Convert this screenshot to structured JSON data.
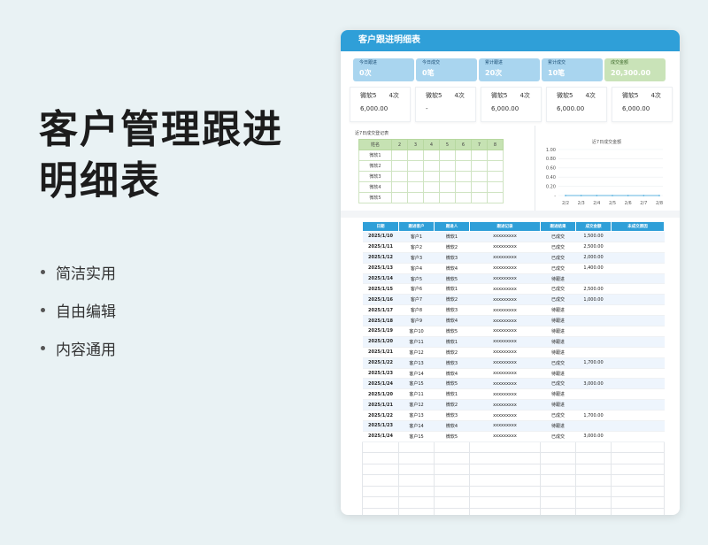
{
  "promo": {
    "title_line1": "客户管理跟进",
    "title_line2": "明细表",
    "bullets": [
      "简洁实用",
      "自由编辑",
      "内容通用"
    ]
  },
  "sheet": {
    "title": "客户跟进明细表",
    "stats": [
      {
        "label": "今日跟进",
        "value": "0次",
        "color": "#a9d5ef"
      },
      {
        "label": "今日成交",
        "value": "0笔",
        "color": "#a9d5ef"
      },
      {
        "label": "累计跟进",
        "value": "20次",
        "color": "#a9d5ef"
      },
      {
        "label": "累计成交",
        "value": "10笔",
        "color": "#a9d5ef"
      },
      {
        "label": "成交金额",
        "value": "20,300.00",
        "color": "#c9e3b8"
      }
    ],
    "cards": [
      {
        "name": "微软5",
        "count": "4次",
        "amount": "6,000.00"
      },
      {
        "name": "微软5",
        "count": "4次",
        "amount": "-"
      },
      {
        "name": "微软5",
        "count": "4次",
        "amount": "6,000.00"
      },
      {
        "name": "微软5",
        "count": "4次",
        "amount": "6,000.00"
      },
      {
        "name": "微软5",
        "count": "4次",
        "amount": "6,000.00"
      }
    ],
    "mini_table": {
      "title": "近7日成交登记表",
      "header": [
        "姓名",
        "2",
        "3",
        "4",
        "5",
        "6",
        "7",
        "8"
      ],
      "rows": [
        "微软1",
        "微软2",
        "微软3",
        "微软4",
        "微软5"
      ]
    },
    "main_table": {
      "headers": [
        "日期",
        "跟进客户",
        "跟进人",
        "跟进记录",
        "跟进结果",
        "成交金额",
        "未成交原因"
      ],
      "rows": [
        [
          "2025/1/10",
          "客户1",
          "微软1",
          "xxxxxxxxx",
          "已成交",
          "1,500.00",
          ""
        ],
        [
          "2025/1/11",
          "客户2",
          "微软2",
          "xxxxxxxxx",
          "已成交",
          "2,500.00",
          ""
        ],
        [
          "2025/1/12",
          "客户3",
          "微软3",
          "xxxxxxxxx",
          "已成交",
          "2,000.00",
          ""
        ],
        [
          "2025/1/13",
          "客户4",
          "微软4",
          "xxxxxxxxx",
          "已成交",
          "1,400.00",
          ""
        ],
        [
          "2025/1/14",
          "客户5",
          "微软5",
          "xxxxxxxxx",
          "待跟进",
          "",
          ""
        ],
        [
          "2025/1/15",
          "客户6",
          "微软1",
          "xxxxxxxxx",
          "已成交",
          "2,500.00",
          ""
        ],
        [
          "2025/1/16",
          "客户7",
          "微软2",
          "xxxxxxxxx",
          "已成交",
          "1,000.00",
          ""
        ],
        [
          "2025/1/17",
          "客户8",
          "微软3",
          "xxxxxxxxx",
          "待跟进",
          "",
          ""
        ],
        [
          "2025/1/18",
          "客户9",
          "微软4",
          "xxxxxxxxx",
          "待跟进",
          "",
          ""
        ],
        [
          "2025/1/19",
          "客户10",
          "微软5",
          "xxxxxxxxx",
          "待跟进",
          "",
          ""
        ],
        [
          "2025/1/20",
          "客户11",
          "微软1",
          "xxxxxxxxx",
          "待跟进",
          "",
          ""
        ],
        [
          "2025/1/21",
          "客户12",
          "微软2",
          "xxxxxxxxx",
          "待跟进",
          "",
          ""
        ],
        [
          "2025/1/22",
          "客户13",
          "微软3",
          "xxxxxxxxx",
          "已成交",
          "1,700.00",
          ""
        ],
        [
          "2025/1/23",
          "客户14",
          "微软4",
          "xxxxxxxxx",
          "待跟进",
          "",
          ""
        ],
        [
          "2025/1/24",
          "客户15",
          "微软5",
          "xxxxxxxxx",
          "已成交",
          "3,000.00",
          ""
        ],
        [
          "2025/1/20",
          "客户11",
          "微软1",
          "xxxxxxxxx",
          "待跟进",
          "",
          ""
        ],
        [
          "2025/1/21",
          "客户12",
          "微软2",
          "xxxxxxxxx",
          "待跟进",
          "",
          ""
        ],
        [
          "2025/1/22",
          "客户13",
          "微软3",
          "xxxxxxxxx",
          "已成交",
          "1,700.00",
          ""
        ],
        [
          "2025/1/23",
          "客户14",
          "微软4",
          "xxxxxxxxx",
          "待跟进",
          "",
          ""
        ],
        [
          "2025/1/24",
          "客户15",
          "微软5",
          "xxxxxxxxx",
          "已成交",
          "3,000.00",
          ""
        ]
      ]
    }
  },
  "chart_data": {
    "type": "line",
    "title": "近7日成交金额",
    "x": [
      "2/2",
      "2/3",
      "2/4",
      "2/5",
      "2/6",
      "2/7",
      "2/8"
    ],
    "yticks": [
      "1.00",
      "0.80",
      "0.60",
      "0.40",
      "0.20",
      "-"
    ],
    "ylim": [
      0,
      1
    ],
    "series": [
      {
        "values": [
          0,
          0,
          0,
          0,
          0,
          0,
          0
        ]
      }
    ],
    "grid": true
  }
}
